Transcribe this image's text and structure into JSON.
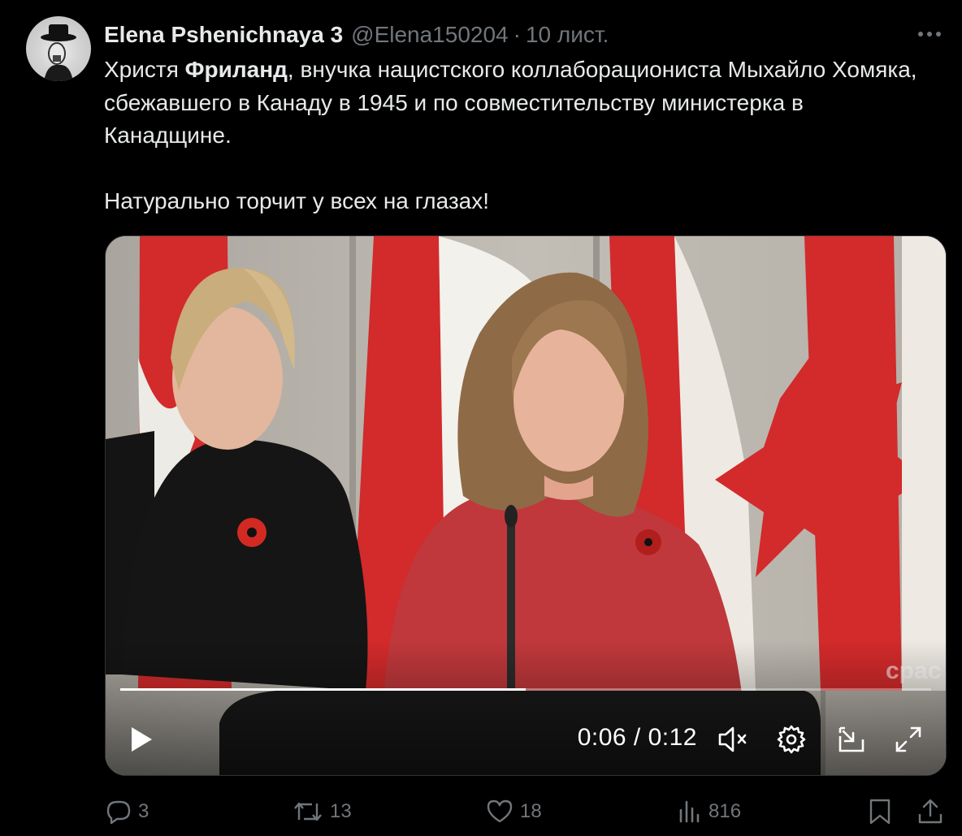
{
  "tweet": {
    "author_name": "Elena Pshenichnaya 3",
    "handle": "@Elena150204",
    "separator": "·",
    "date": "10 лист.",
    "text": {
      "p1_pre": "Христя ",
      "p1_bold": "Фриланд",
      "p1_post": ",  внучка нацистского коллаборациониста Мыхайло Хомяка, сбежавшего в Канаду в 1945 и по совместительству министерка в Канадщине.",
      "p2": "Натурально торчит у всех на глазах!"
    }
  },
  "video": {
    "current_time": "0:06",
    "duration": "0:12",
    "time_display": "0:06 / 0:12",
    "progress": 0.5,
    "watermark": "cpac",
    "icons": [
      "play-icon",
      "muted-speaker-icon",
      "settings-gear-icon",
      "picture-in-picture-icon",
      "fullscreen-icon"
    ]
  },
  "actions": {
    "replies": "3",
    "reposts": "13",
    "likes": "18",
    "views": "816"
  },
  "colors": {
    "background": "#000000",
    "text_primary": "#e7e9ea",
    "text_secondary": "#71767b",
    "flag_red": "#d3282a"
  }
}
